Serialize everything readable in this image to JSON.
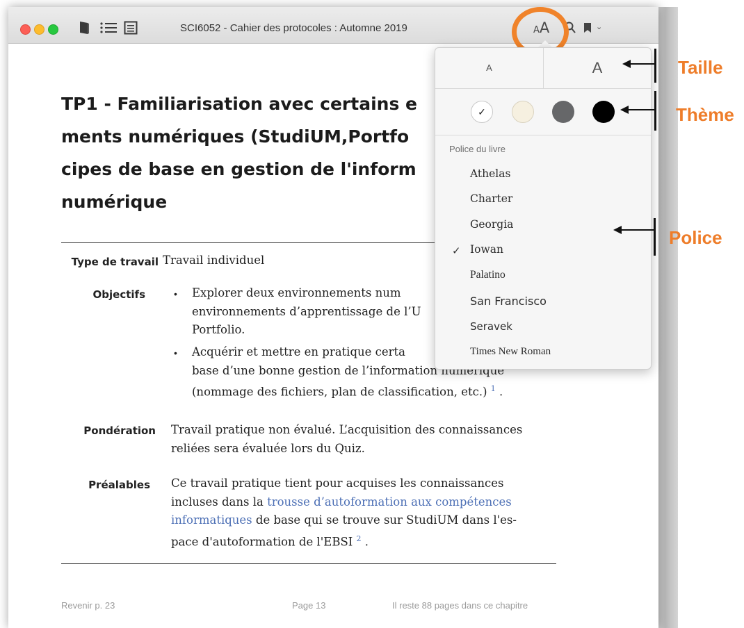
{
  "window": {
    "title": "SCI6052 - Cahier des protocoles : Automne 2019",
    "font_button": {
      "small": "A",
      "big": "A"
    }
  },
  "document": {
    "title_lines": [
      "TP1 - Familiarisation avec certains e",
      "ments numériques (StudiUM,Portfo",
      "cipes de base en gestion de l'inform",
      "numérique"
    ],
    "fields": {
      "type": {
        "label": "Type de travail",
        "text": "Travail individuel"
      },
      "objectifs": {
        "label": "Objectifs",
        "bullet1": [
          "Explorer deux environnements num",
          "environnements d’apprentissage de l’U",
          "Portfolio."
        ],
        "bullet2": [
          "Acquérir et mettre en pratique certa",
          "base d’une bonne gestion de l’information numérique",
          "(nommage des fichiers, plan de classification, etc.)"
        ],
        "footnote": "1"
      },
      "ponderation": {
        "label": "Pondération",
        "lines": [
          "Travail pratique non évalué. L’acquisition des connaissances",
          "reliées sera évaluée lors du Quiz."
        ]
      },
      "prealables": {
        "label": "Préalables",
        "line1": "Ce travail pratique tient pour acquises les connaissances",
        "line2_pre": "incluses dans la ",
        "line2_link": "trousse d’autoformation aux compétences",
        "line3_link": "informatiques",
        "line3_post": " de base qui se trouve sur StudiUM dans l'es-",
        "line4": "pace d'autoformation de l'EBSI",
        "footnote": "2"
      }
    }
  },
  "footer": {
    "back": "Revenir p. 23",
    "page": "Page 13",
    "remaining": "Il reste 88 pages dans ce chapitre"
  },
  "popover": {
    "size_small": "A",
    "size_large": "A",
    "themes": [
      {
        "name": "white",
        "color": "#ffffff",
        "selected": true
      },
      {
        "name": "sepia",
        "color": "#f6f0e0",
        "selected": false
      },
      {
        "name": "gray",
        "color": "#666769",
        "selected": false
      },
      {
        "name": "night",
        "color": "#000000",
        "selected": false
      }
    ],
    "check_glyph": "✓",
    "font_section_label": "Police du livre",
    "fonts": [
      "Athelas",
      "Charter",
      "Georgia",
      "Iowan",
      "Palatino",
      "San Francisco",
      "Seravek",
      "Times New Roman"
    ],
    "selected_font": "Iowan"
  },
  "annotations": {
    "size": "Taille",
    "theme": "Thème",
    "font": "Police",
    "accent_color": "#ee7d2a"
  }
}
